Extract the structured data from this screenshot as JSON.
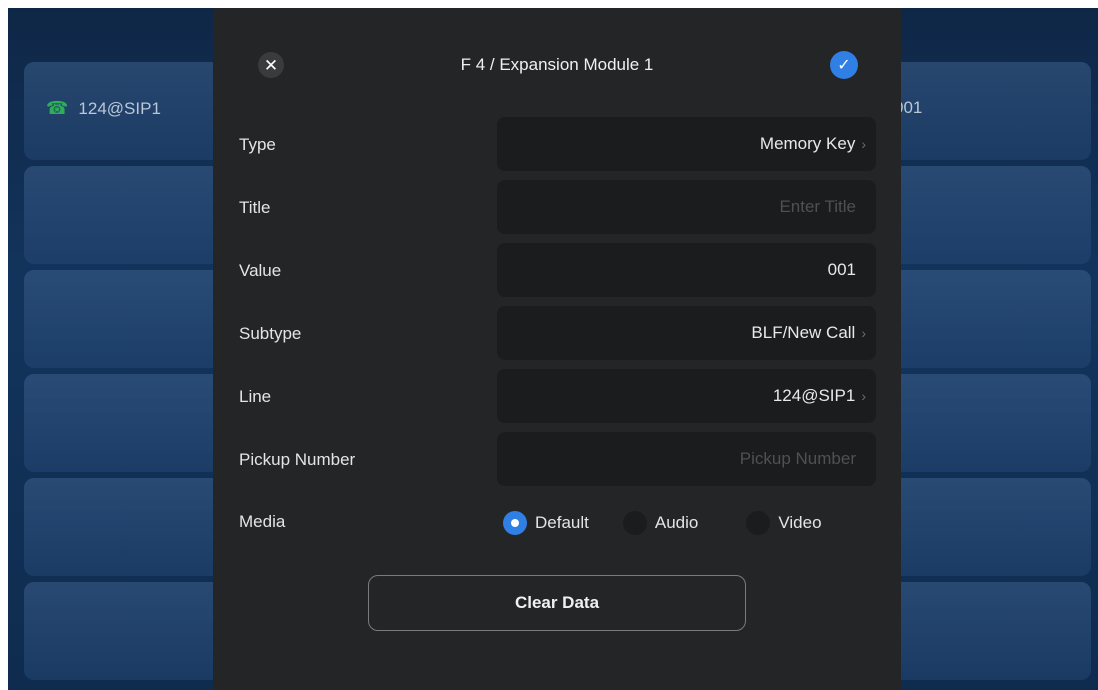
{
  "background": {
    "line_label": "124@SIP1",
    "right_partial": "001"
  },
  "header": {
    "title": "F 4 / Expansion Module 1",
    "close_glyph": "✕",
    "confirm_glyph": "✓"
  },
  "fields": {
    "type": {
      "label": "Type",
      "value": "Memory Key"
    },
    "title": {
      "label": "Title",
      "placeholder": "Enter Title"
    },
    "value": {
      "label": "Value",
      "value": "001"
    },
    "subtype": {
      "label": "Subtype",
      "value": "BLF/New Call"
    },
    "line": {
      "label": "Line",
      "value": "124@SIP1"
    },
    "pickup": {
      "label": "Pickup Number",
      "placeholder": "Pickup Number"
    }
  },
  "media": {
    "label": "Media",
    "options": [
      "Default",
      "Audio",
      "Video"
    ],
    "selected": "Default"
  },
  "clear_button": "Clear Data",
  "colors": {
    "accent": "#2f7fe5",
    "panel": "#242526",
    "field": "#1b1c1d"
  }
}
